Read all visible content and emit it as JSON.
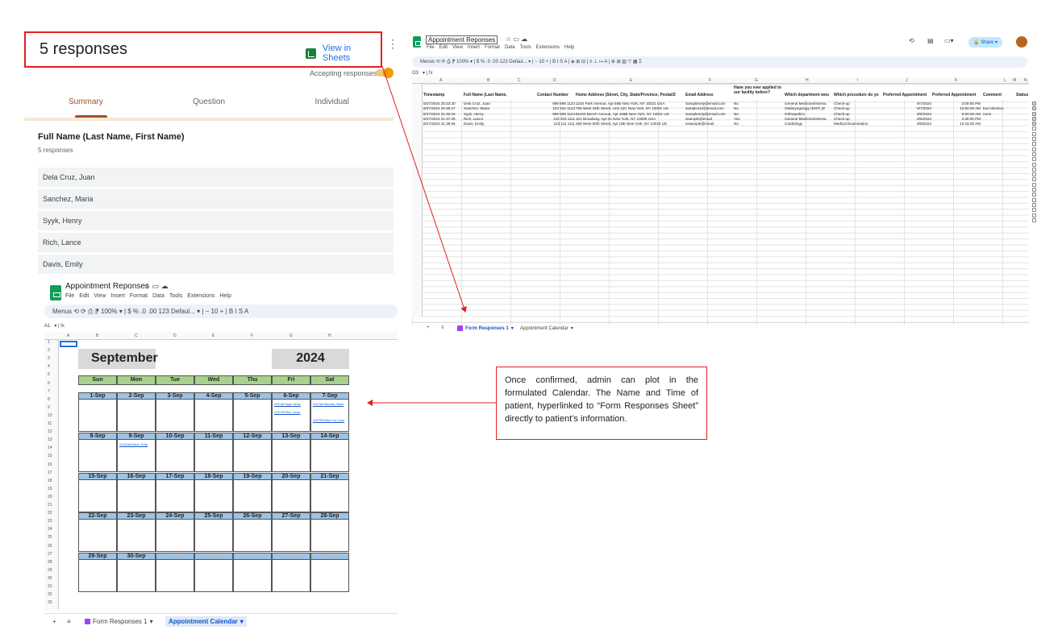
{
  "forms": {
    "responses_title": "5 responses",
    "view_in_sheets": "View in Sheets",
    "accepting": "Accepting responses",
    "tabs": [
      "Summary",
      "Question",
      "Individual"
    ],
    "question_title": "Full Name (Last Name, First Name)",
    "question_count": "5 responses",
    "answers": [
      "Dela Cruz, Juan",
      "Sanchez, Maria",
      "Syyk, Henry",
      "Rich, Lance",
      "Davis, Emily"
    ],
    "accent": "#a0522d"
  },
  "responses_sheet": {
    "doc_title": "Appointment Reponses",
    "menus": [
      "File",
      "Edit",
      "View",
      "Insert",
      "Format",
      "Data",
      "Tools",
      "Extensions",
      "Help"
    ],
    "toolbar": "Menus   ⟲  ⟳  ⎙  ⁋  100% ▾  |  $  %  .0  .00  123  Defaul... ▾  |  −  10  +  |  B  I  S  A  |  ◈  ⊞  ⊟  |  ≡  ⊥  ↦  A  |  ⊕  ⊞  ▥  ▽  ▦  Σ",
    "cell_ref": "O3",
    "fx": "fx",
    "share": "Share",
    "columns": [
      "A",
      "B",
      "C",
      "D",
      "E",
      "F",
      "G",
      "H",
      "I",
      "J",
      "K",
      "L",
      "M",
      "N"
    ],
    "headers": [
      "Timestamp",
      "Full Name (Last Name,",
      "Contact Number",
      "Home Address (Street, City, State/Province, Postal/Z",
      "Email Address",
      "Have you ever applied to our facility before?",
      "Which department wou",
      "Which procedure do yo",
      "Preferred Appointment",
      "Preferred Appointment",
      "Comment",
      "Status"
    ],
    "rows": [
      [
        "8/27/2024 20:23:30",
        "Dela Cruz, Juan",
        "999 999 1123",
        "1234 Park Avenue, Apt 56B New York, NY 10021 USA",
        "Sampleonly@email.com",
        "No",
        "General Medicine/Interna",
        "Check-up",
        "9/7/2024",
        "3:00:00 PM",
        ""
      ],
      [
        "8/27/2024 20:36:27",
        "Sanchez, Maria",
        "123 334 1123",
        "789 West 34th Street, Unit 12C New York, NY 10001 US",
        "sample112@email.com",
        "No",
        "Otolaryngology (ENT) (E",
        "Check-up",
        "9/7/2024",
        "10:00:00 AM",
        "Ear infection"
      ],
      [
        "8/27/2024 21:33:16",
        "Syyk, Henry",
        "999 999 1124",
        "81104 Bench Avenue, Apt 156B New York, NY 10021 US",
        "Sampleonly@email.com",
        "No",
        "Orthopedics",
        "Check-up",
        "9/6/2024",
        "9:00:00 AM",
        "none"
      ],
      [
        "8/27/2024 21:37:29",
        "Rich, Lance",
        "123 333 1111",
        "101 Broadway, Apt 3A New York, NY 10006 USA",
        "ssample@email",
        "Yes",
        "General Medicine/Interna",
        "Check-up",
        "9/6/2024",
        "2:30:00 PM",
        ""
      ],
      [
        "8/27/2024 21:38:06",
        "Davis, Emily",
        "123 111 1111",
        "258 West 50th Street, Apt 19E New York, NY 10019 US",
        "sssample@email",
        "No",
        "Cardiology",
        "Medical Examination",
        "9/9/2024",
        "10:15:00 AM",
        ""
      ]
    ],
    "tab_active": "Form Responses 1",
    "tab_other": "Appointment Calendar"
  },
  "calendar_sheet": {
    "doc_title": "Appointment Reponses",
    "menus": [
      "File",
      "Edit",
      "View",
      "Insert",
      "Format",
      "Data",
      "Tools",
      "Extensions",
      "Help"
    ],
    "toolbar": "Menus   ⟲  ⟳  ⎙  ⁋  100% ▾  |  $  %  .0  .00  123  Defaul... ▾  |  −  10  +  |  B  I  S  A",
    "cell_ref": "A1",
    "fx": "fx",
    "columns": [
      "A",
      "B",
      "C",
      "D",
      "E",
      "F",
      "G",
      "H"
    ],
    "month": "September",
    "year": "2024",
    "weekdays": [
      "Sun",
      "Mon",
      "Tue",
      "Wed",
      "Thu",
      "Fri",
      "Sat"
    ],
    "weeks": [
      [
        "1-Sep",
        "2-Sep",
        "3-Sep",
        "4-Sep",
        "5-Sep",
        "6-Sep",
        "7-Sep"
      ],
      [
        "8-Sep",
        "9-Sep",
        "10-Sep",
        "11-Sep",
        "12-Sep",
        "13-Sep",
        "14-Sep"
      ],
      [
        "15-Sep",
        "16-Sep",
        "17-Sep",
        "18-Sep",
        "19-Sep",
        "20-Sep",
        "21-Sep"
      ],
      [
        "22-Sep",
        "23-Sep",
        "24-Sep",
        "25-Sep",
        "26-Sep",
        "27-Sep",
        "28-Sep"
      ],
      [
        "29-Sep",
        "30-Sep",
        "1-Oct",
        "2-Oct",
        "3-Oct",
        "4-Oct",
        "5-Oct"
      ]
    ],
    "appointments": [
      {
        "week": 0,
        "day": 5,
        "slot": 0,
        "text": "9:00 AM Syyk, Henry"
      },
      {
        "week": 0,
        "day": 6,
        "slot": 0,
        "text": "9:00 AM Sanchez, Maria"
      },
      {
        "week": 0,
        "day": 5,
        "slot": 1,
        "text": "2:30 PM Rich, Lance"
      },
      {
        "week": 0,
        "day": 6,
        "slot": 2,
        "text": "3:00 PM Dela Cruz, Juan"
      },
      {
        "week": 1,
        "day": 1,
        "slot": 0,
        "text": "10:15 AM Davis, Emily"
      }
    ],
    "tab_other": "Form Responses 1",
    "tab_active": "Appointment Calendar"
  },
  "note": "Once confirmed, admin can plot in the formulated Calendar. The Name and Time of patient, hyperlinked to “Form Responses Sheet” directly to patient’s information.",
  "colors": {
    "highlight_red": "#e02020",
    "sheets_green": "#0f9d58",
    "weekday_green": "#a9d18e",
    "date_blue": "#9dc3e6"
  }
}
